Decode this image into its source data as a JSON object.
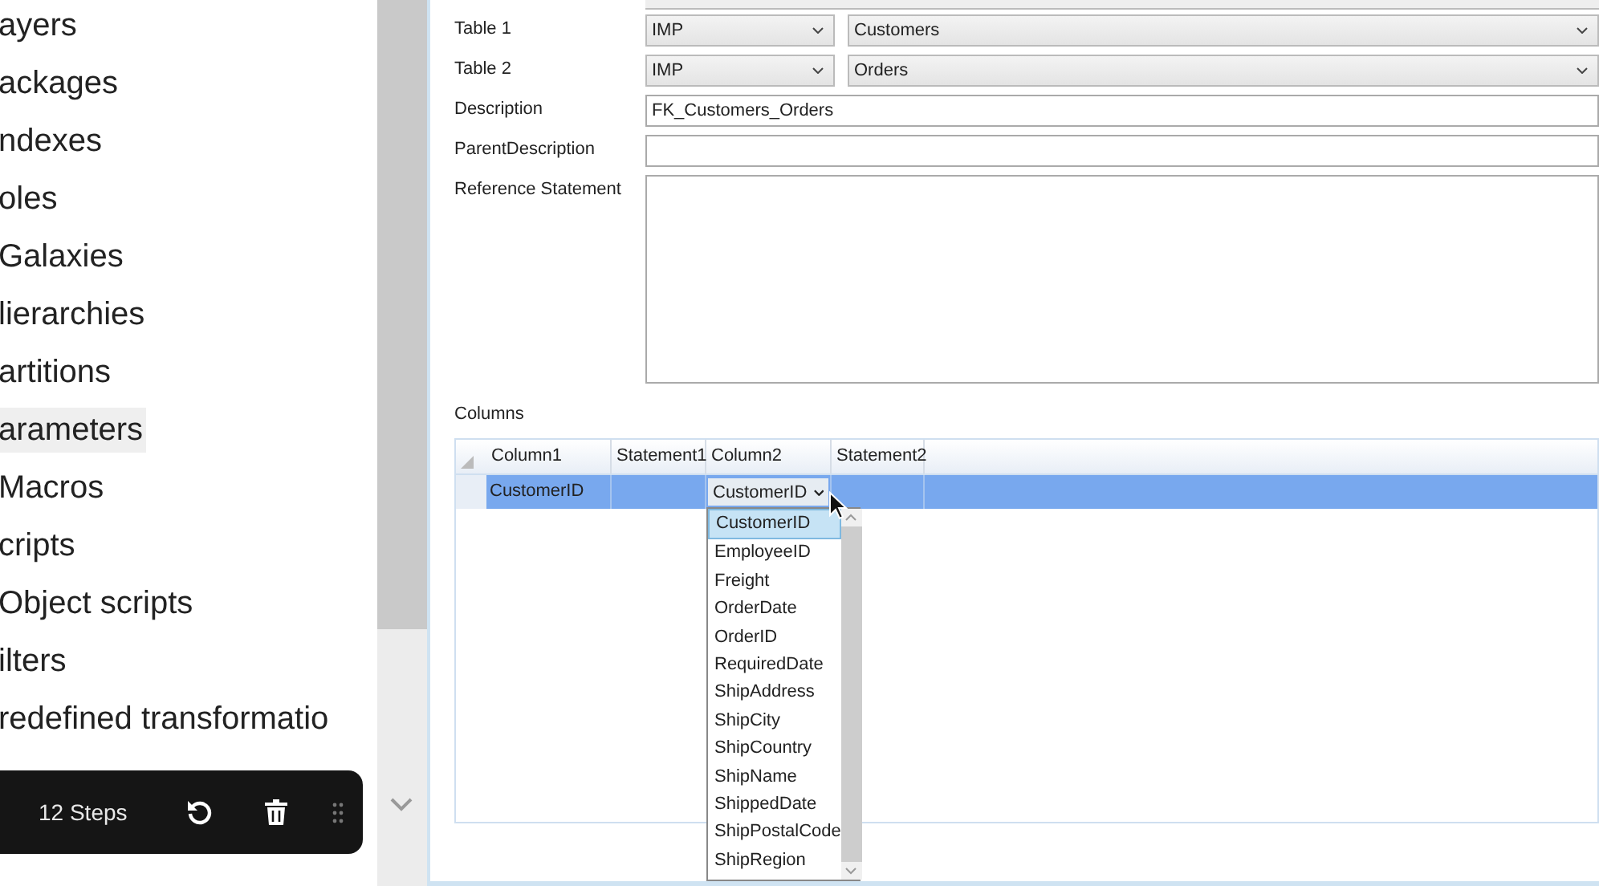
{
  "sidebar": {
    "items": [
      {
        "label": "ayers",
        "selected": false
      },
      {
        "label": "ackages",
        "selected": false
      },
      {
        "label": "ndexes",
        "selected": false
      },
      {
        "label": "oles",
        "selected": false
      },
      {
        "label": "Galaxies",
        "selected": false
      },
      {
        "label": "lierarchies",
        "selected": false
      },
      {
        "label": "artitions",
        "selected": false
      },
      {
        "label": "arameters",
        "selected": true
      },
      {
        "label": "Macros",
        "selected": false
      },
      {
        "label": "cripts",
        "selected": false
      },
      {
        "label": "Object scripts",
        "selected": false
      },
      {
        "label": "ilters",
        "selected": false
      },
      {
        "label": "redefined transformatio",
        "selected": false
      }
    ]
  },
  "toolbar": {
    "steps": "12 Steps"
  },
  "form": {
    "table1": {
      "label": "Table 1",
      "schema": "IMP",
      "table": "Customers"
    },
    "table2": {
      "label": "Table 2",
      "schema": "IMP",
      "table": "Orders"
    },
    "description": {
      "label": "Description",
      "value": "FK_Customers_Orders"
    },
    "parent_description": {
      "label": "ParentDescription"
    },
    "reference_statement": {
      "label": "Reference Statement"
    }
  },
  "columns": {
    "label": "Columns",
    "headers": [
      "Column1",
      "Statement1",
      "Column2",
      "Statement2"
    ],
    "rows": [
      {
        "column1": "CustomerID",
        "column2": "CustomerID",
        "selected": true
      }
    ],
    "dropdown": {
      "options": [
        {
          "label": "CustomerID",
          "selected": true
        },
        {
          "label": "EmployeeID",
          "selected": false
        },
        {
          "label": "Freight",
          "selected": false
        },
        {
          "label": "OrderDate",
          "selected": false
        },
        {
          "label": "OrderID",
          "selected": false
        },
        {
          "label": "RequiredDate",
          "selected": false
        },
        {
          "label": "ShipAddress",
          "selected": false
        },
        {
          "label": "ShipCity",
          "selected": false
        },
        {
          "label": "ShipCountry",
          "selected": false
        },
        {
          "label": "ShipName",
          "selected": false
        },
        {
          "label": "ShippedDate",
          "selected": false
        },
        {
          "label": "ShipPostalCode",
          "selected": false
        },
        {
          "label": "ShipRegion",
          "selected": false
        }
      ]
    }
  }
}
